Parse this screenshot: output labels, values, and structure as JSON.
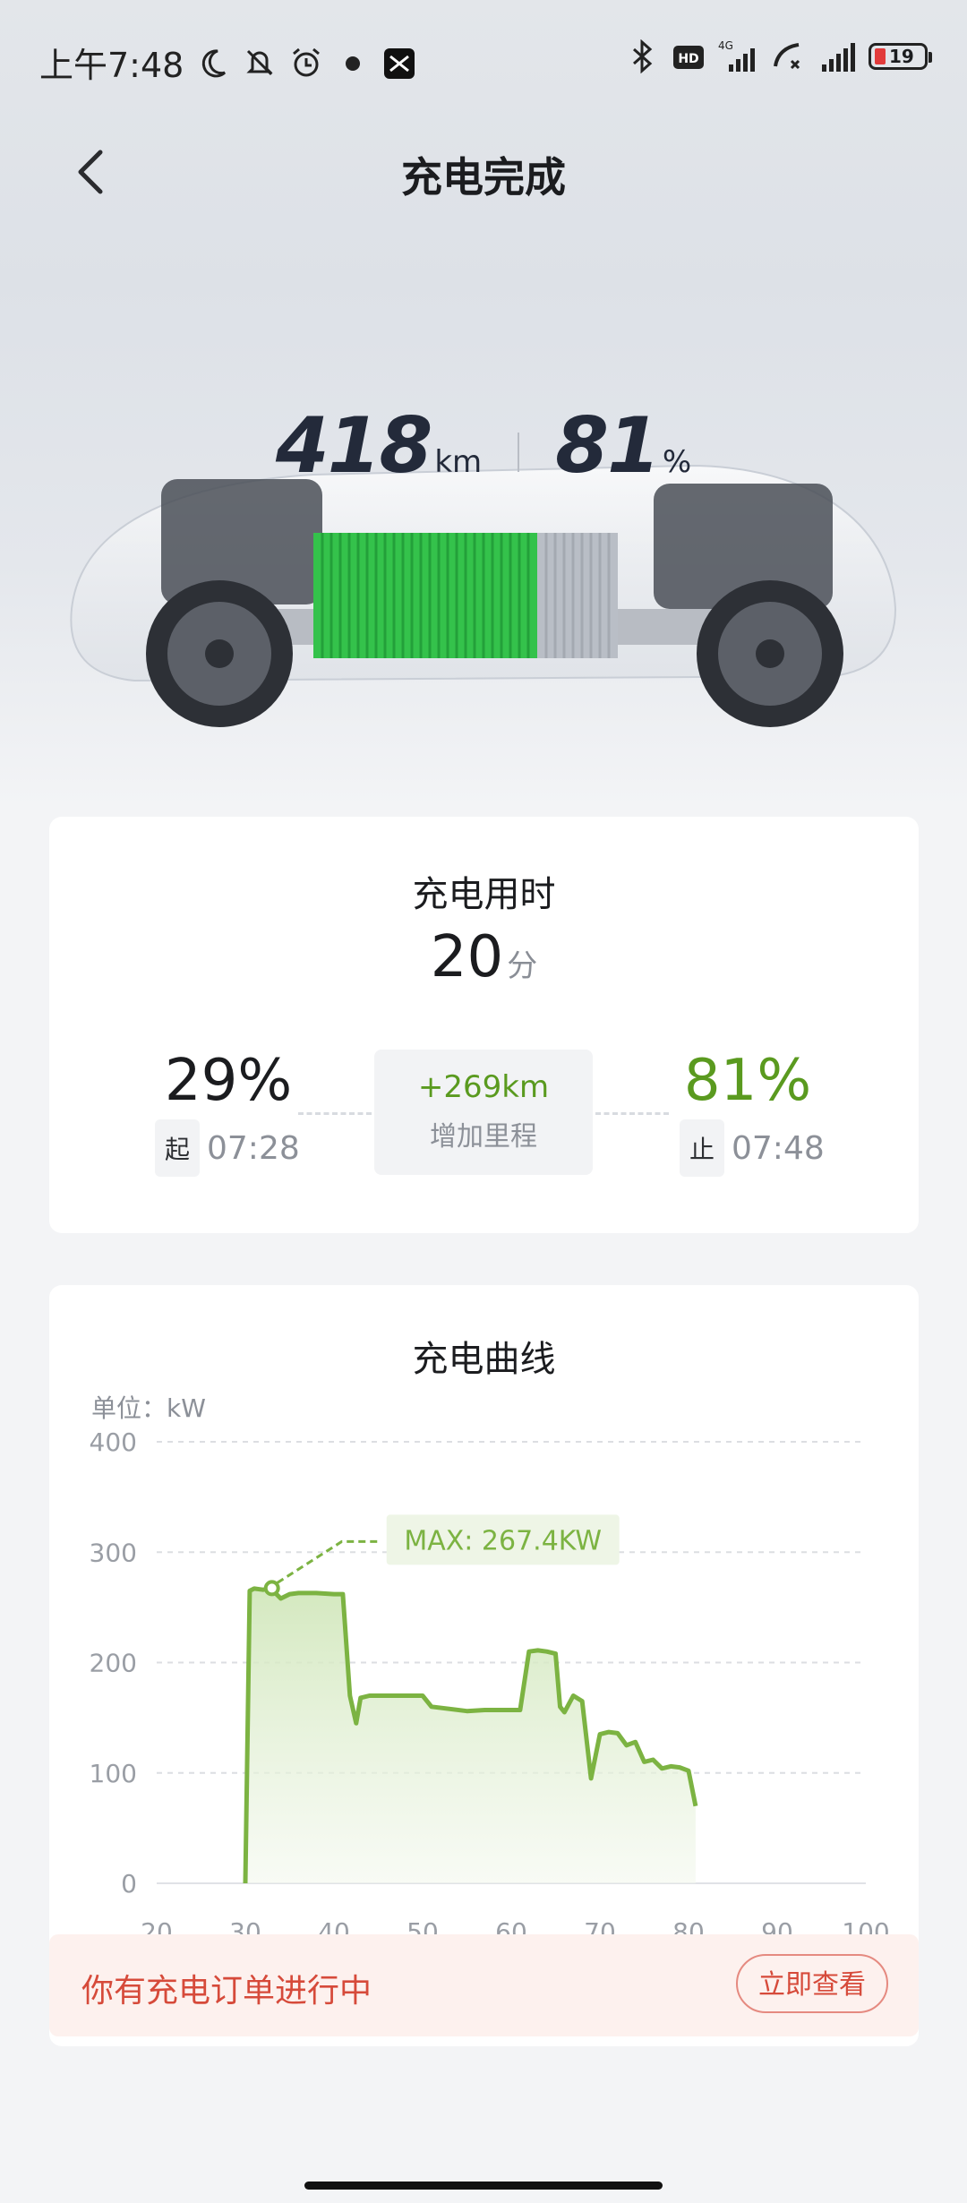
{
  "status_bar": {
    "time": "上午7:48",
    "battery": "19"
  },
  "header": {
    "title": "充电完成"
  },
  "hero": {
    "range_value": "418",
    "range_unit": "km",
    "soc_value": "81",
    "soc_unit": "%"
  },
  "summary": {
    "title": "充电用时",
    "duration_value": "20",
    "duration_unit": "分",
    "start_soc": "29%",
    "start_tag": "起",
    "start_time": "07:28",
    "end_soc": "81%",
    "end_tag": "止",
    "end_time": "07:48",
    "added_range": "+269km",
    "added_range_label": "增加里程"
  },
  "curve": {
    "title": "充电曲线",
    "unit_label": "单位：kW",
    "max_label": "MAX: 267.4KW",
    "accent_color": "#7cb342"
  },
  "chart_data": {
    "type": "area",
    "x_ticks": [
      "20",
      "30",
      "40",
      "50",
      "60",
      "70",
      "80",
      "90",
      "100"
    ],
    "y_ticks": [
      "0",
      "100",
      "200",
      "300",
      "400"
    ],
    "xlim": [
      20,
      100
    ],
    "ylim": [
      0,
      400
    ],
    "x": [
      30,
      30.5,
      31,
      32,
      33,
      33.5,
      34,
      35,
      36,
      38,
      40,
      41,
      41.8,
      42.5,
      43,
      44,
      46,
      49,
      50,
      51,
      55,
      57,
      59,
      61,
      62,
      63,
      64,
      65,
      65.5,
      66,
      67,
      68,
      69,
      70,
      71,
      72,
      73,
      74,
      75,
      76,
      77,
      78,
      79,
      80,
      80.8
    ],
    "values": [
      0,
      265,
      267,
      266,
      267.4,
      262,
      258,
      262,
      263,
      263,
      262,
      262,
      170,
      145,
      168,
      170,
      170,
      170,
      170,
      160,
      156,
      157,
      157,
      157,
      210,
      211,
      210,
      208,
      160,
      155,
      170,
      165,
      95,
      135,
      137,
      136,
      125,
      128,
      110,
      112,
      104,
      106,
      105,
      102,
      70
    ],
    "max": 267.4,
    "max_label": "MAX: 267.4KW"
  },
  "banner": {
    "text": "你有充电订单进行中",
    "button": "立即查看"
  }
}
